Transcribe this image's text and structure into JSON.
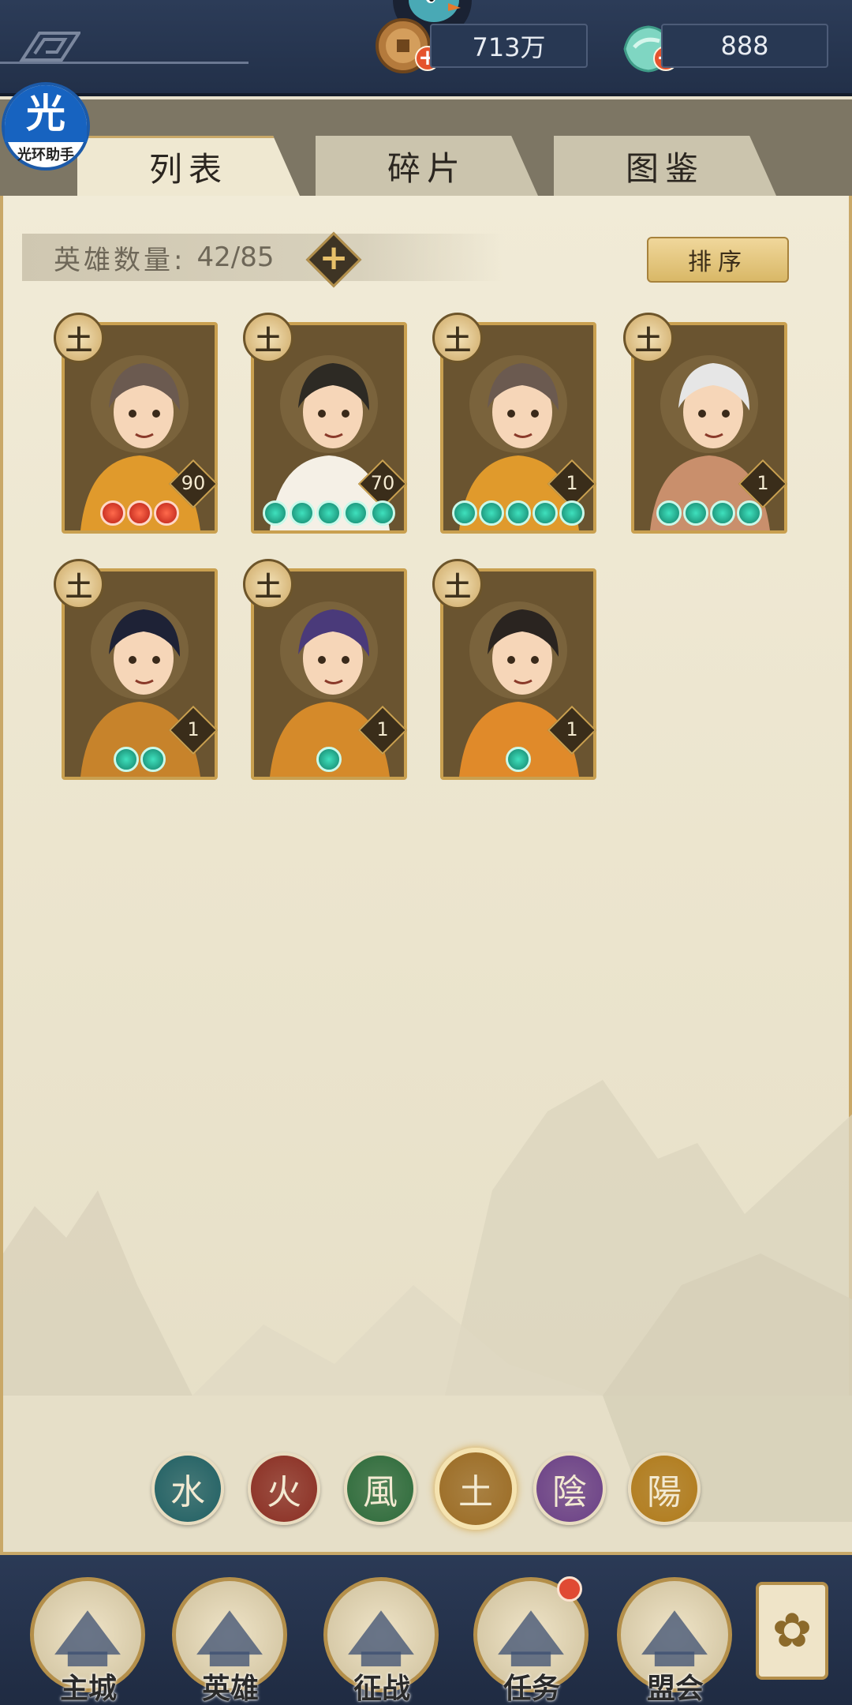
{
  "currencies": {
    "coin": {
      "value": "713万",
      "icon": "copper-coin-icon"
    },
    "gem": {
      "value": "888",
      "icon": "jade-gem-icon"
    }
  },
  "watermark": {
    "glyph": "光",
    "text": "光环助手"
  },
  "tabs": [
    {
      "label": "列表",
      "active": true
    },
    {
      "label": "碎片",
      "active": false
    },
    {
      "label": "图鉴",
      "active": false
    }
  ],
  "hero_count": {
    "label": "英雄数量:",
    "value": "42/85"
  },
  "sort_button": {
    "label": "排序"
  },
  "heroes": [
    {
      "element": "土",
      "level": "90",
      "stars": 3,
      "star_color": "red",
      "hair": "#6b5a50",
      "outfit": "#e09a2c"
    },
    {
      "element": "土",
      "level": "70",
      "stars": 5,
      "star_color": "teal",
      "hair": "#2d2a24",
      "outfit": "#f5f0e6"
    },
    {
      "element": "土",
      "level": "1",
      "stars": 5,
      "star_color": "teal",
      "hair": "#6b5a50",
      "outfit": "#e09a2c"
    },
    {
      "element": "土",
      "level": "1",
      "stars": 4,
      "star_color": "teal",
      "hair": "#e6e6e6",
      "outfit": "#c98f6c"
    },
    {
      "element": "土",
      "level": "1",
      "stars": 2,
      "star_color": "teal",
      "hair": "#1e2236",
      "outfit": "#c7832b"
    },
    {
      "element": "土",
      "level": "1",
      "stars": 1,
      "star_color": "teal",
      "hair": "#4a3a7a",
      "outfit": "#d58a2a"
    },
    {
      "element": "土",
      "level": "1",
      "stars": 1,
      "star_color": "teal",
      "hair": "#2a2420",
      "outfit": "#e08a2a"
    }
  ],
  "element_filters": [
    {
      "glyph": "水",
      "color": "#1f5f63"
    },
    {
      "glyph": "火",
      "color": "#8a2d22"
    },
    {
      "glyph": "風",
      "color": "#2c6a3a"
    },
    {
      "glyph": "土",
      "color": "#9a6a22",
      "selected": true
    },
    {
      "glyph": "陰",
      "color": "#6a3f86"
    },
    {
      "glyph": "陽",
      "color": "#b07a1a"
    }
  ],
  "bottom_nav": [
    {
      "label": "主城",
      "icon": "city-gate-icon"
    },
    {
      "label": "英雄",
      "icon": "hero-portrait-icon",
      "active": true
    },
    {
      "label": "征战",
      "icon": "campaign-scroll-icon"
    },
    {
      "label": "任务",
      "icon": "task-scroll-icon",
      "badge": true
    },
    {
      "label": "盟会",
      "icon": "guild-pavilion-icon"
    }
  ],
  "menu_icon": "lattice-menu-icon"
}
